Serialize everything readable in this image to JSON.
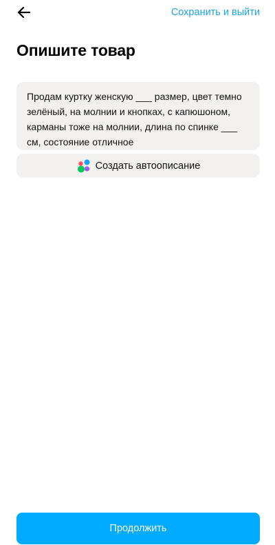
{
  "header": {
    "back_icon": "arrow-left-icon",
    "save_exit_label": "Сохранить и выйти"
  },
  "page": {
    "title": "Опишите товар"
  },
  "description": {
    "value": "Продам куртку женскую ___ размер, цвет темно зелёный, на молнии и кнопках, с капюшоном, карманы тоже на молнии, длина по спинке ___ см, состояние отличное"
  },
  "autodescription": {
    "icon": "ai-dots-icon",
    "label": "Создать автоописание"
  },
  "footer": {
    "continue_label": "Продолжить"
  },
  "colors": {
    "accent": "#00aaff",
    "link": "#1aa3f0",
    "field_background": "#f2f1f0"
  }
}
